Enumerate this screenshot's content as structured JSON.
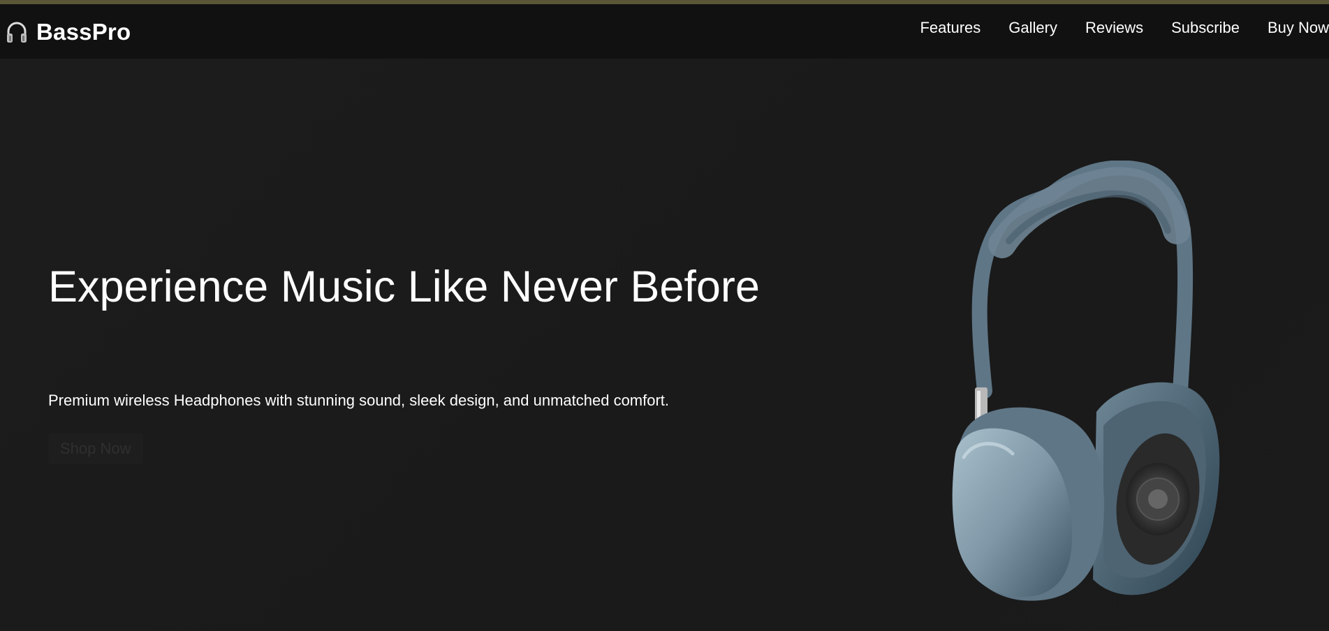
{
  "navbar": {
    "brand_name": "BassPro",
    "brand_icon": "headphones-icon",
    "links": [
      "Features",
      "Gallery",
      "Reviews",
      "Subscribe",
      "Buy Now"
    ]
  },
  "hero": {
    "title": "Experience Music Like Never Before",
    "subtitle": "Premium wireless Headphones with stunning sound, sleek design, and unmatched comfort.",
    "cta_label": "Shop Now"
  },
  "colors": {
    "background": "#1b1b1b",
    "navbar": "#111111",
    "text": "#ffffff",
    "headphone_blue": "#5f7686",
    "top_stripe": "#5b5637"
  }
}
